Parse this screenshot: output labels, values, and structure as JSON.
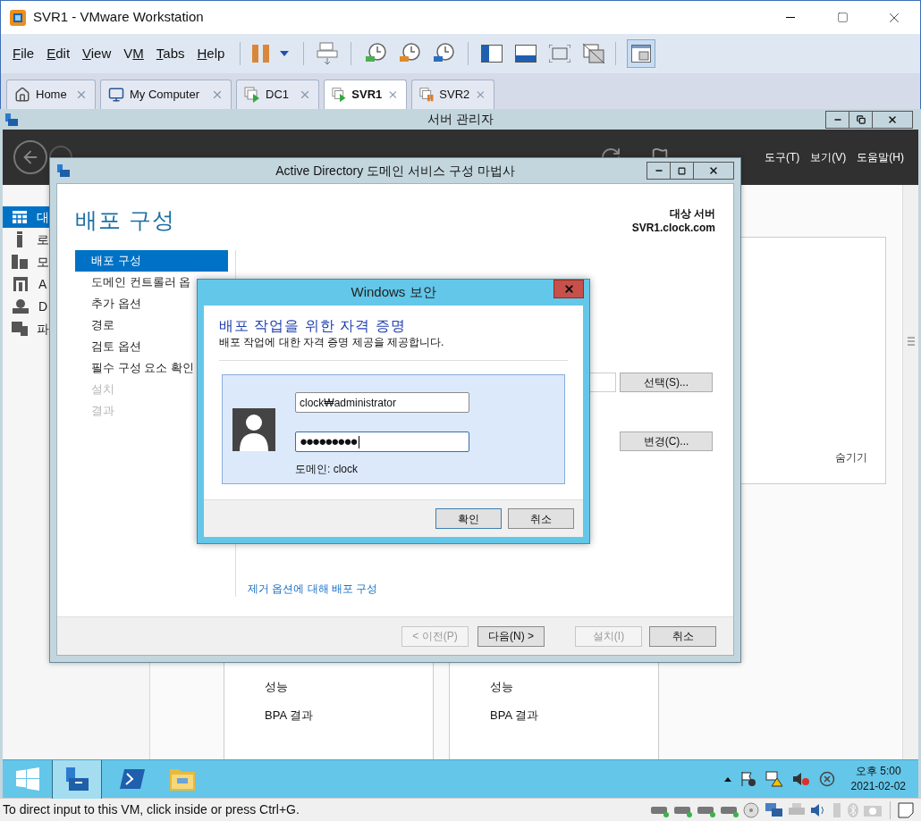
{
  "window": {
    "title": "SVR1 - VMware Workstation"
  },
  "menu": [
    {
      "key": "F",
      "post": "ile"
    },
    {
      "key": "E",
      "post": "dit"
    },
    {
      "key": "V",
      "post": "iew"
    },
    {
      "pre": "V",
      "key": "M"
    },
    {
      "key": "T",
      "post": "abs"
    },
    {
      "key": "H",
      "post": "elp"
    }
  ],
  "tabs": [
    {
      "label": "Home",
      "kind": "home",
      "selected": false
    },
    {
      "label": "My Computer",
      "kind": "computer",
      "selected": false
    },
    {
      "label": "DC1",
      "kind": "vm-running",
      "selected": false
    },
    {
      "label": "SVR1",
      "kind": "vm-running",
      "selected": true
    },
    {
      "label": "SVR2",
      "kind": "vm-paused",
      "selected": false
    }
  ],
  "server_manager": {
    "title": "서버 관리자",
    "menu": [
      "도구(T)",
      "보기(V)",
      "도움말(H)"
    ],
    "sidebar": [
      {
        "label": "대",
        "kind": "dashboard",
        "selected": true
      },
      {
        "label": "로",
        "kind": "local",
        "selected": false
      },
      {
        "label": "모",
        "kind": "all",
        "selected": false
      },
      {
        "label": "A",
        "kind": "ad",
        "selected": false
      },
      {
        "label": "D",
        "kind": "dns",
        "selected": false
      },
      {
        "label": "파",
        "kind": "files",
        "selected": false
      }
    ],
    "panel": {
      "hide_label": "숨기기"
    },
    "tiles": [
      {
        "items": [
          "성능",
          "BPA 결과"
        ]
      },
      {
        "items": [
          "성능",
          "BPA 결과"
        ]
      }
    ]
  },
  "wizard": {
    "title": "Active Directory 도메인 서비스 구성 마법사",
    "heading": "배포 구성",
    "target_label": "대상 서버",
    "target_server": "SVR1.clock.com",
    "steps": [
      {
        "label": "배포 구성",
        "selected": true,
        "disabled": false
      },
      {
        "label": "도메인 컨트롤러 옵",
        "selected": false,
        "disabled": false
      },
      {
        "label": "추가 옵션",
        "selected": false,
        "disabled": false
      },
      {
        "label": "경로",
        "selected": false,
        "disabled": false
      },
      {
        "label": "검토 옵션",
        "selected": false,
        "disabled": false
      },
      {
        "label": "필수 구성 요소 확인",
        "selected": false,
        "disabled": false
      },
      {
        "label": "설치",
        "selected": false,
        "disabled": true
      },
      {
        "label": "결과",
        "selected": false,
        "disabled": true
      }
    ],
    "buttons": [
      "선택(S)...",
      "변경(C)..."
    ],
    "link": "제거 옵션에 대해 배포 구성",
    "footer_buttons": [
      {
        "label": "< 이전(P)",
        "disabled": true
      },
      {
        "label": "다음(N) >",
        "disabled": false
      },
      {
        "label": "설치(I)",
        "disabled": true
      },
      {
        "label": "취소",
        "disabled": false
      }
    ]
  },
  "dialog": {
    "title": "Windows 보안",
    "heading": "배포 작업을 위한 자격 증명",
    "subtitle": "배포 작업에 대한 자격 증명 제공을 제공합니다.",
    "username": "clock₩administrator",
    "password": "●●●●●●●●●",
    "domain": "도메인: clock",
    "buttons": [
      {
        "label": "확인",
        "default": true
      },
      {
        "label": "취소",
        "default": false
      }
    ]
  },
  "taskbar": {
    "apps": [
      {
        "kind": "start",
        "selected": false
      },
      {
        "kind": "server-manager",
        "selected": true
      },
      {
        "kind": "powershell",
        "selected": false
      },
      {
        "kind": "explorer",
        "selected": false
      }
    ],
    "time": "오후 5:00",
    "date": "2021-02-02"
  },
  "status_bar": {
    "text": "To direct input to this VM, click inside or press Ctrl+G."
  }
}
